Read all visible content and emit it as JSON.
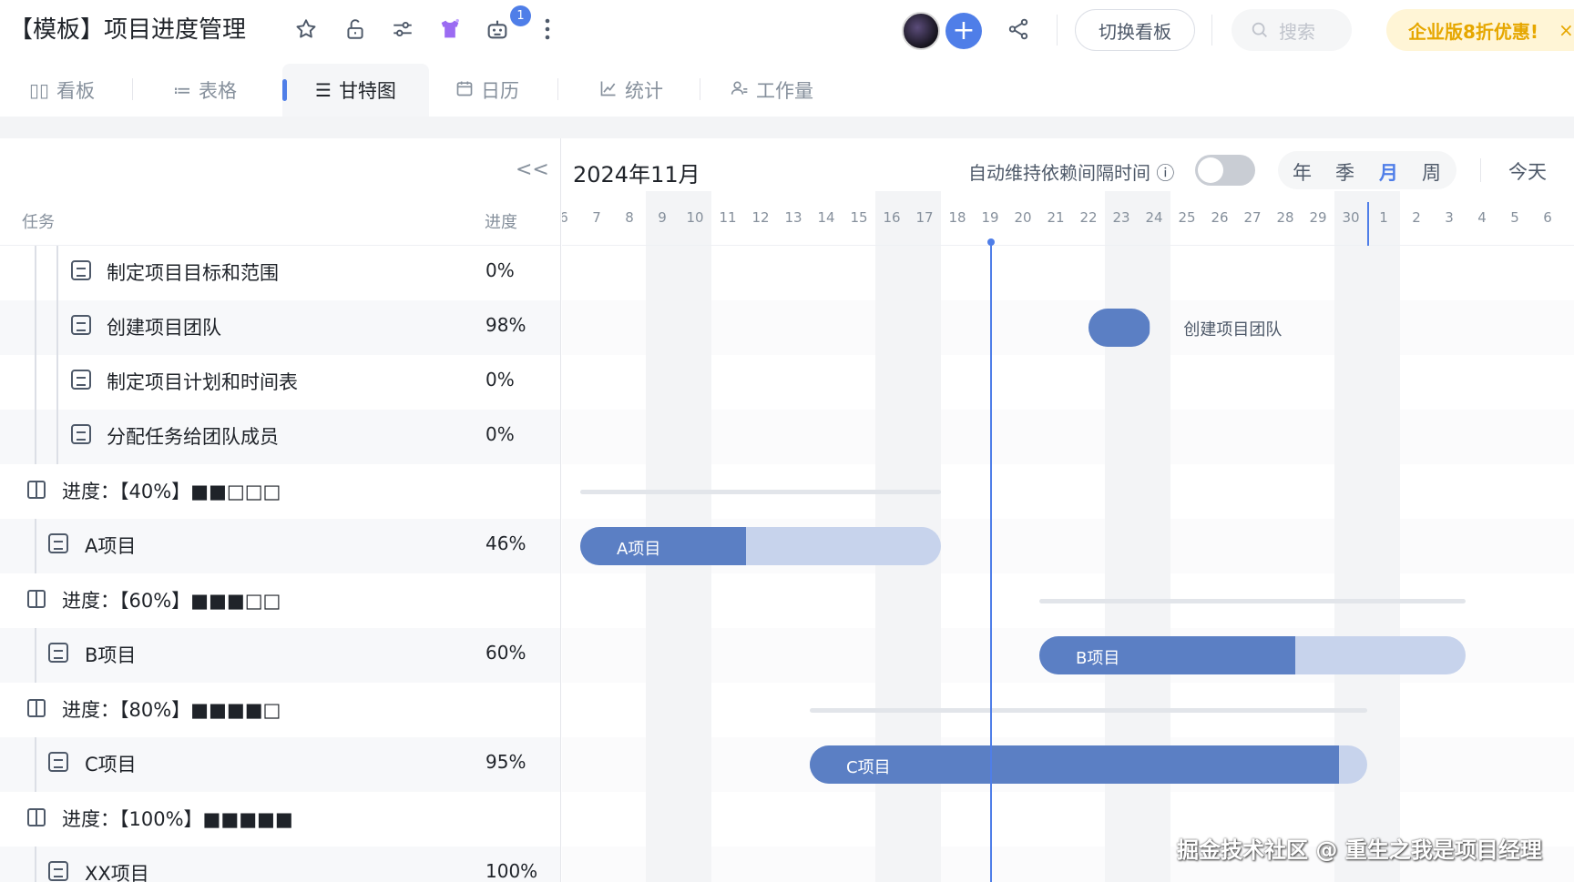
{
  "header": {
    "title": "【模板】项目进度管理",
    "robot_badge": "1",
    "switch_board": "切换看板",
    "search_placeholder": "搜索",
    "promo": "企业版8折优惠!",
    "promo_close": "×",
    "icons": [
      "star-icon",
      "unlock-icon",
      "filter-settings-icon",
      "skin-theme-icon",
      "robot-icon",
      "more-vertical-icon",
      "add-member-icon",
      "share-icon",
      "search-icon"
    ]
  },
  "tabs": [
    {
      "label": "看板",
      "icon": "kanban-icon",
      "glyph": "▯▯"
    },
    {
      "label": "表格",
      "icon": "table-icon",
      "glyph": "≔"
    },
    {
      "label": "甘特图",
      "icon": "gantt-icon",
      "glyph": "☰"
    },
    {
      "label": "日历",
      "icon": "calendar-icon",
      "glyph": "🗓"
    },
    {
      "label": "统计",
      "icon": "chart-icon",
      "glyph": "📈"
    },
    {
      "label": "工作量",
      "icon": "workload-icon",
      "glyph": "⚇"
    }
  ],
  "active_tab": "甘特图",
  "task_list": {
    "collapse": "<<",
    "col_task": "任务",
    "col_progress": "进度",
    "rows": [
      {
        "name": "制定项目目标和范围",
        "progress": "0%",
        "type": "subtask"
      },
      {
        "name": "创建项目团队",
        "progress": "98%",
        "type": "subtask"
      },
      {
        "name": "制定项目计划和时间表",
        "progress": "0%",
        "type": "subtask"
      },
      {
        "name": "分配任务给团队成员",
        "progress": "0%",
        "type": "subtask"
      },
      {
        "name": "进度：【40%】■■□□□",
        "progress": "",
        "type": "group"
      },
      {
        "name": "A项目",
        "progress": "46%",
        "type": "task"
      },
      {
        "name": "进度：【60%】■■■□□",
        "progress": "",
        "type": "group"
      },
      {
        "name": "B项目",
        "progress": "60%",
        "type": "task"
      },
      {
        "name": "进度：【80%】■■■■□",
        "progress": "",
        "type": "group"
      },
      {
        "name": "C项目",
        "progress": "95%",
        "type": "task"
      },
      {
        "name": "进度：【100%】■■■■■",
        "progress": "",
        "type": "group"
      },
      {
        "name": "XX项目",
        "progress": "100%",
        "type": "task"
      }
    ]
  },
  "gantt": {
    "month_title": "2024年11月",
    "auto_keep_label": "自动维持依赖间隔时间 ⓘ",
    "auto_keep_on": false,
    "scales": [
      "年",
      "季",
      "月",
      "周"
    ],
    "active_scale": "月",
    "today_button": "今天",
    "days": [
      "6",
      "7",
      "8",
      "9",
      "10",
      "11",
      "12",
      "13",
      "14",
      "15",
      "16",
      "17",
      "18",
      "19",
      "20",
      "21",
      "22",
      "23",
      "24",
      "25",
      "26",
      "27",
      "28",
      "29",
      "30",
      "1",
      "2",
      "3",
      "4",
      "5",
      "6"
    ],
    "today_index": 13,
    "month_boundary_index": 25,
    "weekend_indices": [
      3,
      4,
      10,
      11,
      17,
      18,
      24,
      25
    ],
    "bars": [
      {
        "row": 1,
        "label": "创建项目团队",
        "start": 16,
        "end": 17.9,
        "progress": 0.98,
        "label_outside": true
      },
      {
        "row": 4,
        "summary": true,
        "start": 0.5,
        "end": 11.5
      },
      {
        "row": 5,
        "label": "A项目",
        "start": 0.5,
        "end": 11.5,
        "progress": 0.46
      },
      {
        "row": 6,
        "summary": true,
        "start": 14.5,
        "end": 27.5
      },
      {
        "row": 7,
        "label": "B项目",
        "start": 14.5,
        "end": 27.5,
        "progress": 0.6
      },
      {
        "row": 8,
        "summary": true,
        "start": 7.5,
        "end": 24.5
      },
      {
        "row": 9,
        "label": "C项目",
        "start": 7.5,
        "end": 24.5,
        "progress": 0.95
      }
    ]
  },
  "watermark": "掘金技术社区 @ 重生之我是项目经理",
  "colors": {
    "accent": "#4f7ee8",
    "bar_fill": "#5b7fc4",
    "bar_track": "#c7d3ec",
    "promo": "#e6a700"
  }
}
